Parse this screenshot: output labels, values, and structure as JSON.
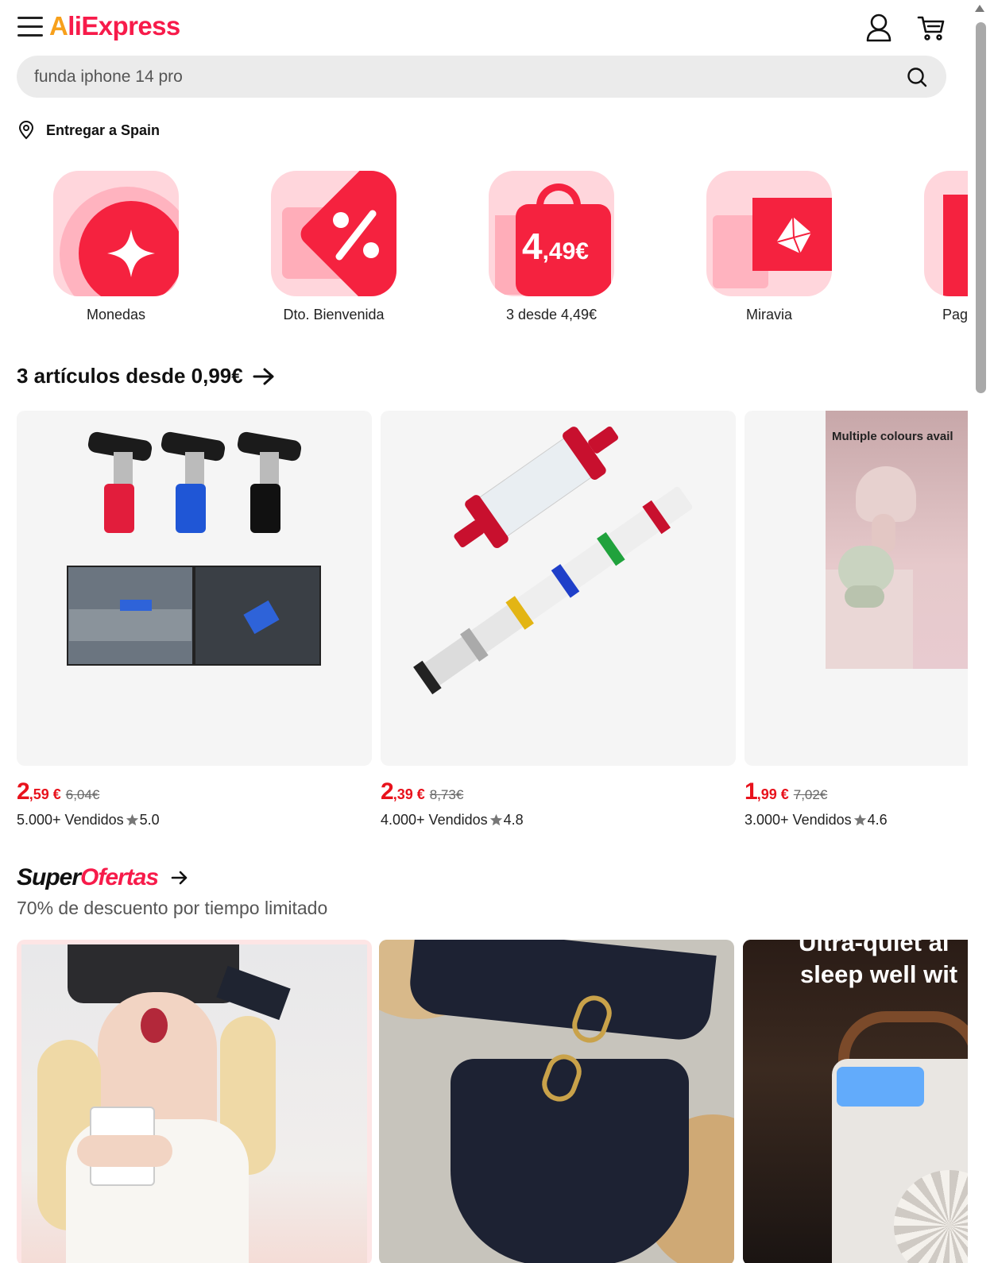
{
  "brand": {
    "logo_text_first": "A",
    "logo_text_rest": "liExpress",
    "accent": "#f71b4a",
    "accent2": "#f7a01b"
  },
  "header": {
    "menu_icon": "hamburger-icon",
    "account_icon": "user-icon",
    "cart_icon": "cart-icon"
  },
  "search": {
    "value": "funda iphone 14 pro",
    "icon": "search-icon"
  },
  "delivery": {
    "label": "Entregar a Spain",
    "icon": "location-pin-icon"
  },
  "categories": [
    {
      "label": "Monedas",
      "icon": "coin-star-icon"
    },
    {
      "label": "Dto. Bienvenida",
      "icon": "discount-tag-icon"
    },
    {
      "label": "3 desde 4,49€",
      "icon": "shopping-bag-icon",
      "badge_int": "4",
      "badge_dec": ",49€"
    },
    {
      "label": "Miravia",
      "icon": "truck-icon"
    },
    {
      "label": "Pag",
      "icon": "partial-icon"
    }
  ],
  "section_bundle": {
    "title": "3 artículos desde 0,99€",
    "products": [
      {
        "price_int": "2",
        "price_dec": ",59 €",
        "old_price": "6,04€",
        "sold": "5.000+ Vendidos",
        "rating": "5.0"
      },
      {
        "price_int": "2",
        "price_dec": ",39 €",
        "old_price": "8,73€",
        "sold": "4.000+ Vendidos",
        "rating": "4.8"
      },
      {
        "price_int": "1",
        "price_dec": ",99 €",
        "old_price": "7,02€",
        "sold": "3.000+ Vendidos",
        "rating": "4.6",
        "image_text": "Multiple colours avail"
      }
    ]
  },
  "super_ofertas": {
    "title_a": "Super",
    "title_b": "Ofertas",
    "subtitle": "70% de descuento por tiempo limitado",
    "deals": [
      {
        "image": "vr-headset-photo"
      },
      {
        "image": "black-swimsuit-photo"
      },
      {
        "image": "air-cooler-photo",
        "image_text_1": "Ultra-quiet ai",
        "image_text_2": "sleep well wit"
      }
    ]
  }
}
